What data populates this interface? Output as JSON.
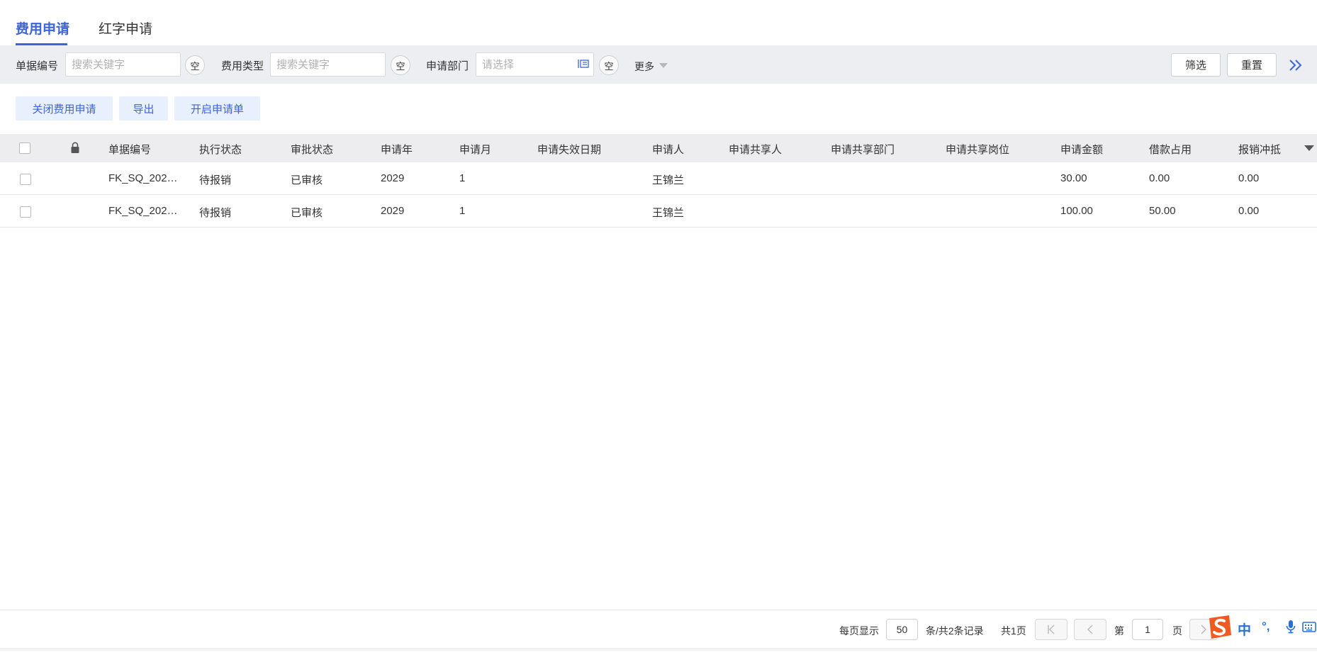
{
  "tabs": [
    {
      "label": "费用申请",
      "active": true
    },
    {
      "label": "红字申请",
      "active": false
    }
  ],
  "filters": {
    "doc_no_label": "单据编号",
    "doc_no_placeholder": "搜索关键字",
    "fee_type_label": "费用类型",
    "fee_type_placeholder": "搜索关键字",
    "dept_label": "申请部门",
    "dept_placeholder": "请选择",
    "empty_label": "空",
    "more_label": "更多",
    "filter_button": "筛选",
    "reset_button": "重置"
  },
  "actions": {
    "close_apply": "关闭费用申请",
    "export": "导出",
    "open_apply": "开启申请单"
  },
  "table": {
    "columns": [
      "单据编号",
      "执行状态",
      "审批状态",
      "申请年",
      "申请月",
      "申请失效日期",
      "申请人",
      "申请共享人",
      "申请共享部门",
      "申请共享岗位",
      "申请金额",
      "借款占用",
      "报销冲抵"
    ],
    "rows": [
      {
        "doc_no": "FK_SQ_202…",
        "exec_status": "待报销",
        "approve_status": "已审核",
        "year": "2029",
        "month": "1",
        "expire_date": "",
        "applicant": "王锦兰",
        "sharer": "",
        "share_dept": "",
        "share_post": "",
        "amount": "30.00",
        "loan": "0.00",
        "offset": "0.00"
      },
      {
        "doc_no": "FK_SQ_202…",
        "exec_status": "待报销",
        "approve_status": "已审核",
        "year": "2029",
        "month": "1",
        "expire_date": "",
        "applicant": "王锦兰",
        "sharer": "",
        "share_dept": "",
        "share_post": "",
        "amount": "100.00",
        "loan": "50.00",
        "offset": "0.00"
      }
    ]
  },
  "pagination": {
    "per_page_label": "每页显示",
    "per_page_value": "50",
    "records_label": "条/共2条记录",
    "total_pages": "共1页",
    "page_prefix": "第",
    "page_value": "1",
    "page_suffix": "页"
  },
  "ime": {
    "lang": "中",
    "punct": "°,"
  },
  "colors": {
    "accent": "#3d64d8",
    "action_bg": "#e8effd",
    "filter_bg": "#edeef1",
    "header_bg": "#ededf0",
    "ime_logo": "#f05a22"
  }
}
